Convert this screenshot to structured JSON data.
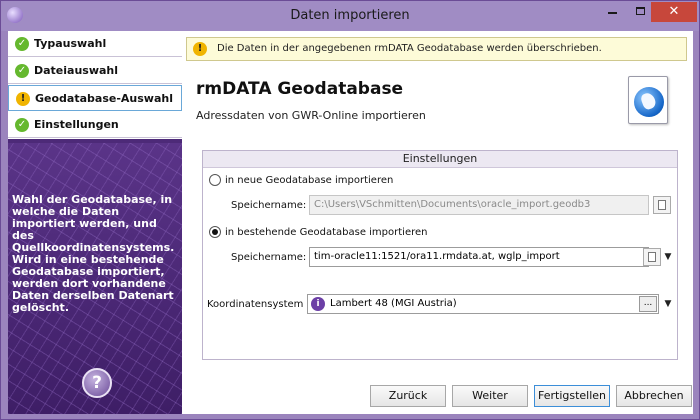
{
  "window": {
    "title": "Daten importieren",
    "minimize": "—",
    "close": "✕"
  },
  "sidebar": {
    "steps": [
      {
        "label": "Typauswahl",
        "status": "ok",
        "icon": "check-icon"
      },
      {
        "label": "Dateiauswahl",
        "status": "ok",
        "icon": "check-icon"
      },
      {
        "label": "Geodatabase-Auswahl",
        "status": "warning",
        "icon": "warning-icon",
        "active": true
      },
      {
        "label": "Einstellungen",
        "status": "ok",
        "icon": "check-icon"
      }
    ],
    "description": "Wahl der Geodatabase, in welche die Daten importiert werden, und des Quellkoordinatensystems. Wird in eine bestehende Geodatabase importiert, werden dort vorhandene Daten derselben Datenart gelöscht.",
    "help": "?"
  },
  "notice": {
    "text": "Die Daten in der angegebenen rmDATA Geodatabase werden überschrieben.",
    "icon": "warning-icon"
  },
  "header": {
    "title": "rmDATA Geodatabase",
    "subtitle": "Adressdaten von GWR-Online importieren",
    "icon": "globe-document-icon"
  },
  "settings": {
    "title": "Einstellungen",
    "option_new": {
      "label": "in neue Geodatabase importieren",
      "checked": false,
      "path_label": "Speichername:",
      "path_value": "C:\\Users\\VSchmitten\\Documents\\oracle_import.geodb3"
    },
    "option_existing": {
      "label": "in bestehende Geodatabase importieren",
      "checked": true,
      "path_label": "Speichername:",
      "path_value": "tim-oracle11:1521/ora11.rmdata.at, wglp_import"
    },
    "crs": {
      "label": "Koordinatensystem",
      "value": "Lambert 48 (MGI Austria)",
      "icon_glyph": "i",
      "dots": "..."
    }
  },
  "buttons": {
    "back": "Zurück",
    "next": "Weiter",
    "finish": "Fertigstellen",
    "cancel": "Abbrechen"
  },
  "colors": {
    "accent": "#4d2a78",
    "titlebar": "#a08cc4",
    "ok": "#65b82e",
    "warning": "#f0b400",
    "close": "#c7473b"
  }
}
